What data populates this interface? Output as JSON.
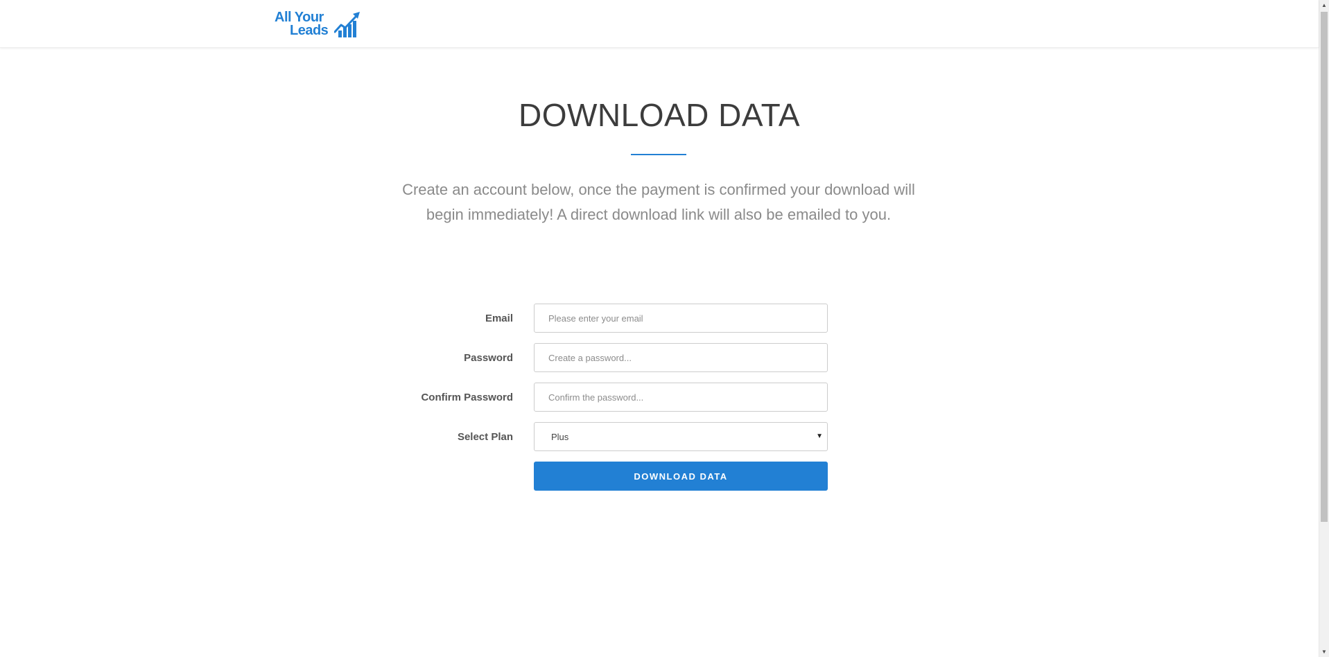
{
  "header": {
    "logo_line1": "All Your",
    "logo_line2": "Leads"
  },
  "main": {
    "title": "DOWNLOAD DATA",
    "subtitle": "Create an account below, once the payment is confirmed your download will begin immediately! A direct download link will also be emailed to you."
  },
  "form": {
    "email": {
      "label": "Email",
      "placeholder": "Please enter your email",
      "value": ""
    },
    "password": {
      "label": "Password",
      "placeholder": "Create a password...",
      "value": ""
    },
    "confirm_password": {
      "label": "Confirm Password",
      "placeholder": "Confirm the password...",
      "value": ""
    },
    "plan": {
      "label": "Select Plan",
      "selected": "Plus"
    },
    "submit_label": "DOWNLOAD DATA"
  },
  "colors": {
    "accent": "#2280d4",
    "title": "#3c3c3c",
    "subtitle": "#8a8a8a",
    "label": "#555555"
  },
  "icons": {
    "logo": "rising-bar-chart-arrow-icon",
    "select_caret": "caret-down-icon",
    "scroll_up": "scroll-up-arrow-icon",
    "scroll_down": "scroll-down-arrow-icon"
  }
}
